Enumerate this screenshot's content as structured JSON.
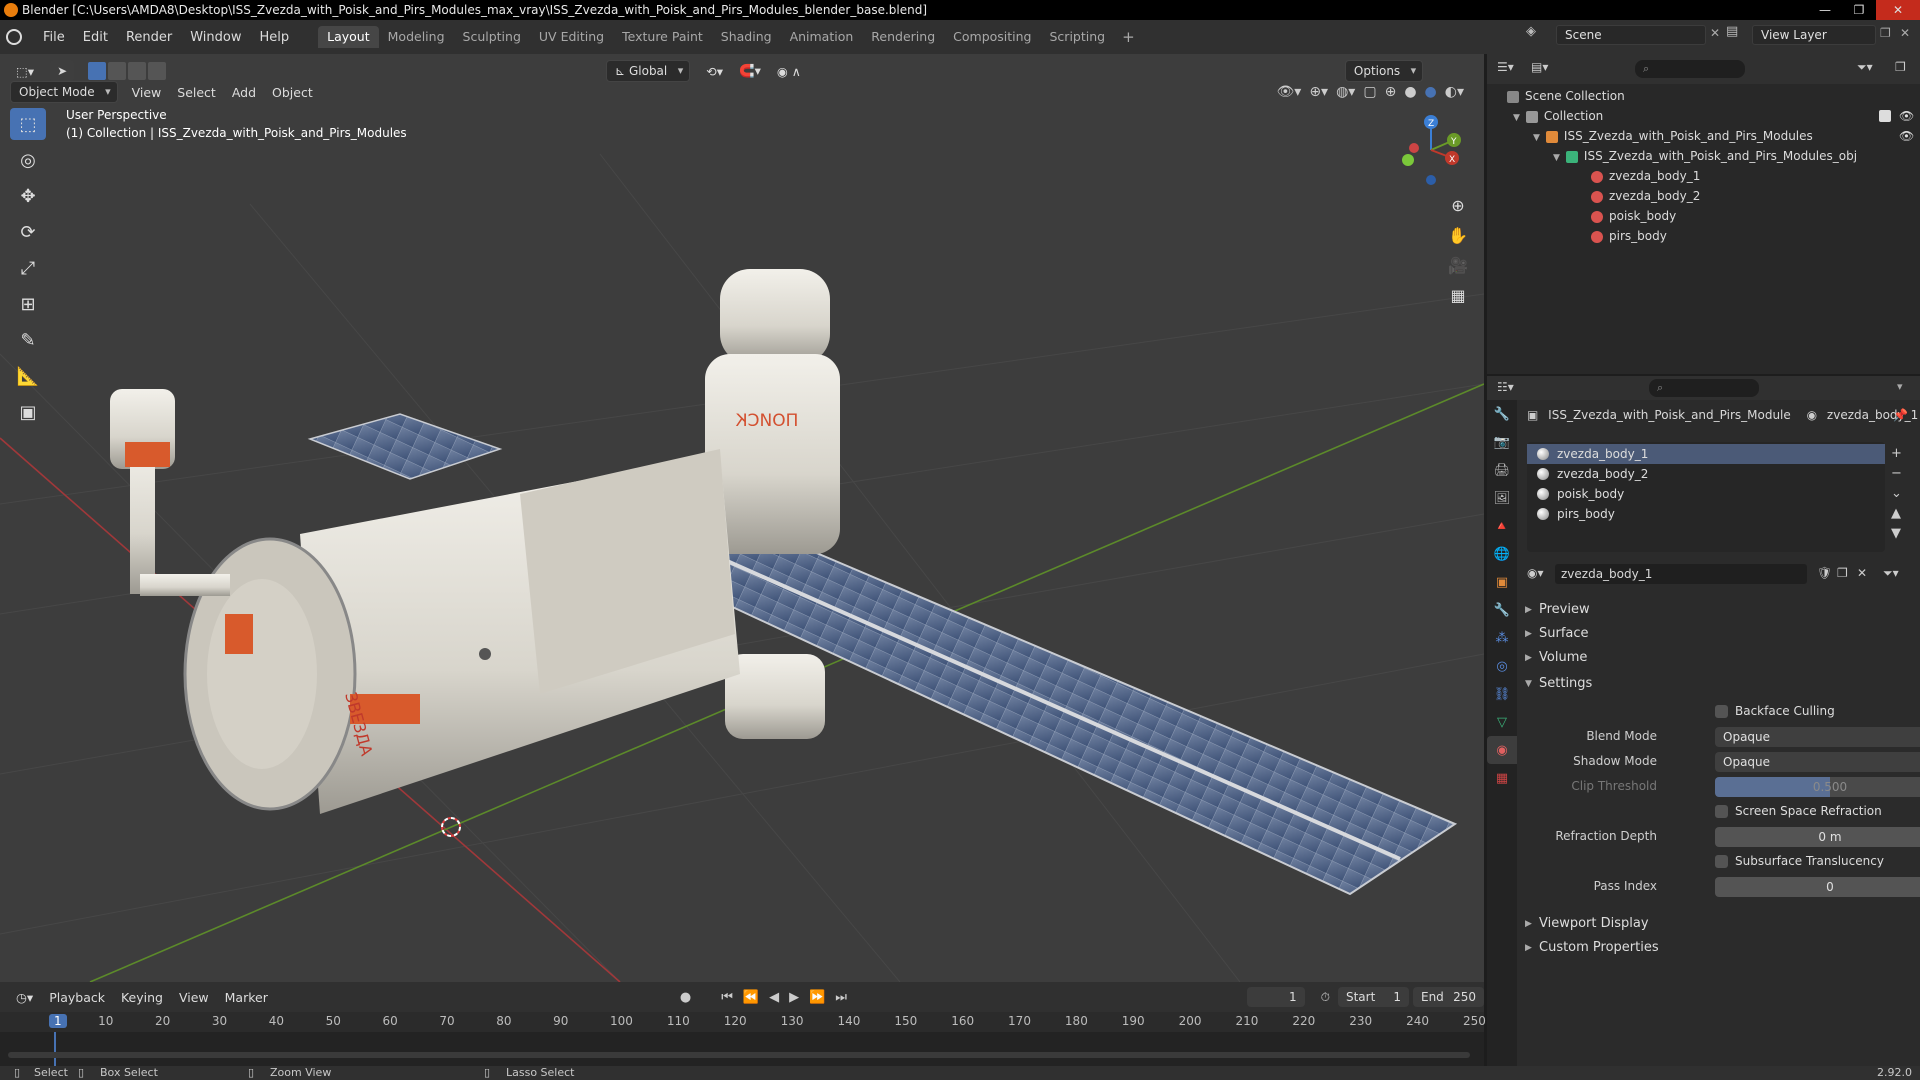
{
  "window": {
    "title": "Blender [C:\\Users\\AMDA8\\Desktop\\ISS_Zvezda_with_Poisk_and_Pirs_Modules_max_vray\\ISS_Zvezda_with_Poisk_and_Pirs_Modules_blender_base.blend]"
  },
  "menu": [
    "File",
    "Edit",
    "Render",
    "Window",
    "Help"
  ],
  "workspace_tabs": [
    "Layout",
    "Modeling",
    "Sculpting",
    "UV Editing",
    "Texture Paint",
    "Shading",
    "Animation",
    "Rendering",
    "Compositing",
    "Scripting"
  ],
  "scene": {
    "name": "Scene",
    "view_layer": "View Layer"
  },
  "viewport": {
    "mode": "Object Mode",
    "menus": [
      "View",
      "Select",
      "Add",
      "Object"
    ],
    "orientation": "Global",
    "options_label": "Options",
    "overlay_title": "User Perspective",
    "overlay_subtitle": "(1) Collection | ISS_Zvezda_with_Poisk_and_Pirs_Modules",
    "poisk_label": "ПОИСК",
    "zvezda_label": "ЗВЕЗДА",
    "gizmo_axes": [
      "X",
      "Y",
      "Z"
    ]
  },
  "outliner": {
    "scene_collection": "Scene Collection",
    "collection": "Collection",
    "object": "ISS_Zvezda_with_Poisk_and_Pirs_Modules",
    "mesh": "ISS_Zvezda_with_Poisk_and_Pirs_Modules_obj",
    "materials": [
      "zvezda_body_1",
      "zvezda_body_2",
      "poisk_body",
      "pirs_body"
    ]
  },
  "properties": {
    "breadcrumb_object": "ISS_Zvezda_with_Poisk_and_Pirs_Module",
    "breadcrumb_material": "zvezda_body_1",
    "slots": [
      "zvezda_body_1",
      "zvezda_body_2",
      "poisk_body",
      "pirs_body"
    ],
    "active_material": "zvezda_body_1",
    "panels_closed_top": [
      "Preview",
      "Surface",
      "Volume"
    ],
    "settings_panel": "Settings",
    "backface_culling": "Backface Culling",
    "blend_mode_label": "Blend Mode",
    "blend_mode_value": "Opaque",
    "shadow_mode_label": "Shadow Mode",
    "shadow_mode_value": "Opaque",
    "clip_threshold_label": "Clip Threshold",
    "clip_threshold_value": "0.500",
    "screen_space_refraction": "Screen Space Refraction",
    "refraction_depth_label": "Refraction Depth",
    "refraction_depth_value": "0 m",
    "subsurface_translucency": "Subsurface Translucency",
    "pass_index_label": "Pass Index",
    "pass_index_value": "0",
    "panels_closed_bottom": [
      "Viewport Display",
      "Custom Properties"
    ]
  },
  "timeline": {
    "menus": [
      "Playback",
      "Keying",
      "View",
      "Marker"
    ],
    "current_frame": "1",
    "start_label": "Start",
    "start_value": "1",
    "end_label": "End",
    "end_value": "250",
    "ruler": [
      "1",
      "10",
      "20",
      "30",
      "40",
      "50",
      "60",
      "70",
      "80",
      "90",
      "100",
      "110",
      "120",
      "130",
      "140",
      "150",
      "160",
      "170",
      "180",
      "190",
      "200",
      "210",
      "220",
      "230",
      "240",
      "250"
    ]
  },
  "statusbar": {
    "select": "Select",
    "box_select": "Box Select",
    "zoom_view": "Zoom View",
    "lasso_select": "Lasso Select",
    "version": "2.92.0"
  },
  "colors": {
    "accent": "#4772b3",
    "viewport_bg": "#3d3d3d",
    "x_axis": "#c0392b",
    "y_axis": "#6a9a27",
    "z_axis": "#3b7fd6"
  }
}
